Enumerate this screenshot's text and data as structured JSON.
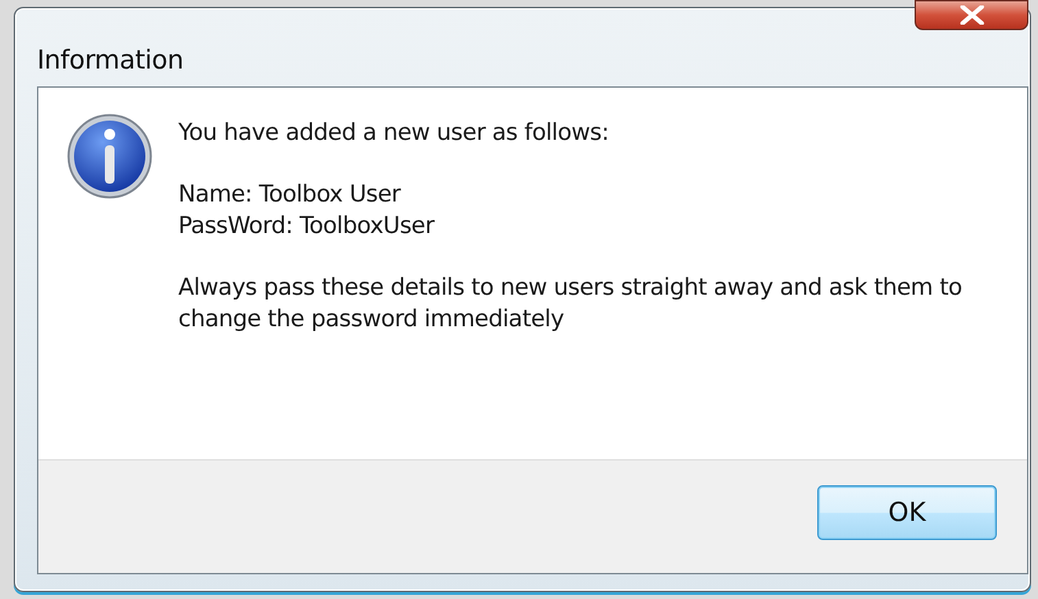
{
  "window": {
    "title": "Information"
  },
  "message": {
    "paragraphs": [
      [
        "You have added a new user as follows:"
      ],
      [
        "Name: Toolbox User",
        "PassWord: ToolboxUser"
      ],
      [
        "Always pass these details to new users straight away and ask them to change the password immediately"
      ]
    ]
  },
  "buttons": [
    {
      "label": "OK",
      "default": true
    }
  ]
}
